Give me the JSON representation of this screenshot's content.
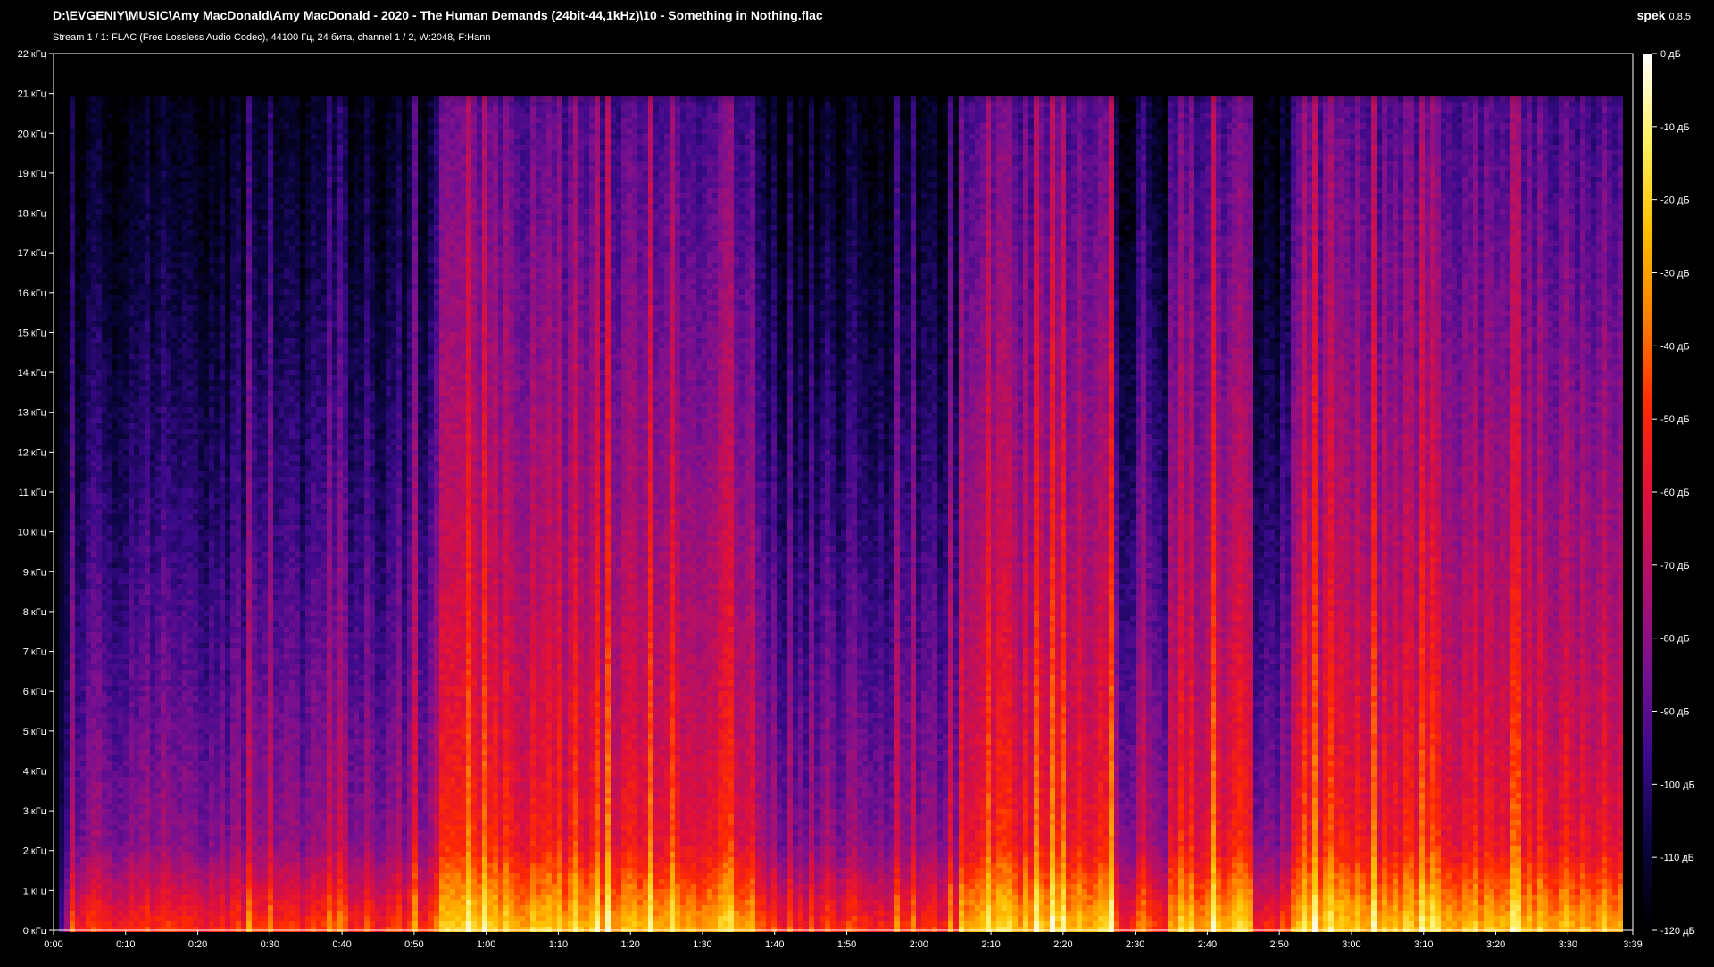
{
  "window": {
    "file_path": "D:\\EVGENIY\\MUSIC\\Amy MacDonald\\Amy MacDonald - 2020 - The Human Demands (24bit-44,1kHz)\\10 - Something in Nothing.flac",
    "stream_info": "Stream 1 / 1: FLAC (Free Lossless Audio Codec), 44100 Гц, 24 бита, channel 1 / 2, W:2048, F:Hann",
    "app_name": "spek",
    "app_version": "0.8.5"
  },
  "chart_data": {
    "type": "heatmap",
    "title": "",
    "x_axis": {
      "unit": "time",
      "range_seconds": [
        0,
        219
      ],
      "tick_labels": [
        "0:00",
        "0:10",
        "0:20",
        "0:30",
        "0:40",
        "0:50",
        "1:00",
        "1:10",
        "1:20",
        "1:30",
        "1:40",
        "1:50",
        "2:00",
        "2:10",
        "2:20",
        "2:30",
        "2:40",
        "2:50",
        "3:00",
        "3:10",
        "3:20",
        "3:30",
        "3:39"
      ],
      "tick_seconds": [
        0,
        10,
        20,
        30,
        40,
        50,
        60,
        70,
        80,
        90,
        100,
        110,
        120,
        130,
        140,
        150,
        160,
        170,
        180,
        190,
        200,
        210,
        219
      ]
    },
    "y_axis": {
      "unit": "kHz",
      "range": [
        0,
        22
      ],
      "tick_labels": [
        "0 кГц",
        "1 кГц",
        "2 кГц",
        "3 кГц",
        "4 кГц",
        "5 кГц",
        "6 кГц",
        "7 кГц",
        "8 кГц",
        "9 кГц",
        "10 кГц",
        "11 кГц",
        "12 кГц",
        "13 кГц",
        "14 кГц",
        "15 кГц",
        "16 кГц",
        "17 кГц",
        "18 кГц",
        "19 кГц",
        "20 кГц",
        "21 кГц",
        "22 кГц"
      ],
      "tick_values": [
        0,
        1,
        2,
        3,
        4,
        5,
        6,
        7,
        8,
        9,
        10,
        11,
        12,
        13,
        14,
        15,
        16,
        17,
        18,
        19,
        20,
        21,
        22
      ]
    },
    "color_scale": {
      "range_db": [
        -120,
        0
      ],
      "tick_labels": [
        "0 дБ",
        "-10 дБ",
        "-20 дБ",
        "-30 дБ",
        "-40 дБ",
        "-50 дБ",
        "-60 дБ",
        "-70 дБ",
        "-80 дБ",
        "-90 дБ",
        "-100 дБ",
        "-110 дБ",
        "-120 дБ"
      ],
      "tick_values": [
        0,
        -10,
        -20,
        -30,
        -40,
        -50,
        -60,
        -70,
        -80,
        -90,
        -100,
        -110,
        -120
      ],
      "colors": [
        "#000000",
        "#0a0540",
        "#3a0a8a",
        "#7a1090",
        "#b0106a",
        "#e0103a",
        "#ff2a00",
        "#ff8000",
        "#ffc000",
        "#fff060",
        "#ffffff"
      ]
    },
    "content_cutoff_khz": 21,
    "audio_end_seconds": 217,
    "high_energy_sections_seconds": [
      [
        53,
        97
      ],
      [
        125,
        147
      ],
      [
        154,
        166
      ],
      [
        171,
        217
      ]
    ]
  }
}
